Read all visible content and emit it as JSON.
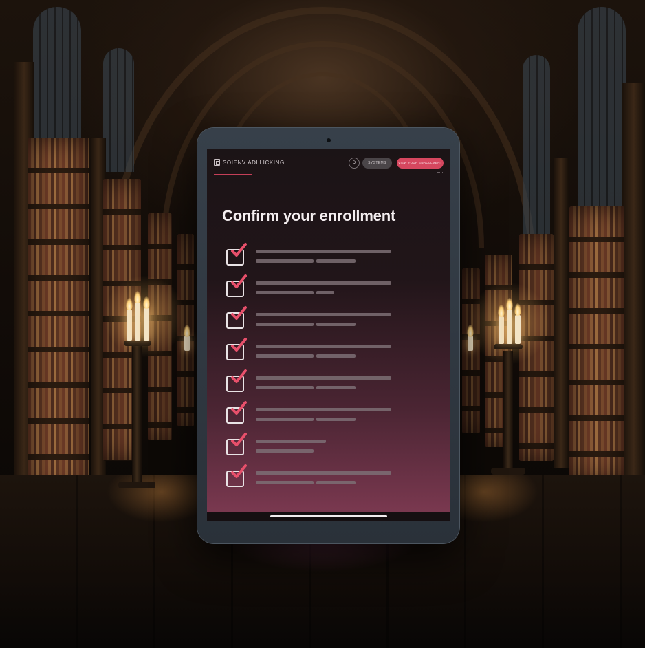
{
  "app": {
    "brand_name": "SOIENV ADLLICKING",
    "brand_icon": "book-icon",
    "help_label": "D",
    "secondary_button_label": "SYSTEMS",
    "primary_button_label": "VIEW YOUR ENROLLMENT",
    "accent_color": "#d6475f"
  },
  "main": {
    "title": "Confirm your enrollment",
    "check_icon": "checkmark-icon",
    "checkmark_color": "#e8506b",
    "items_checked_count": 8
  }
}
